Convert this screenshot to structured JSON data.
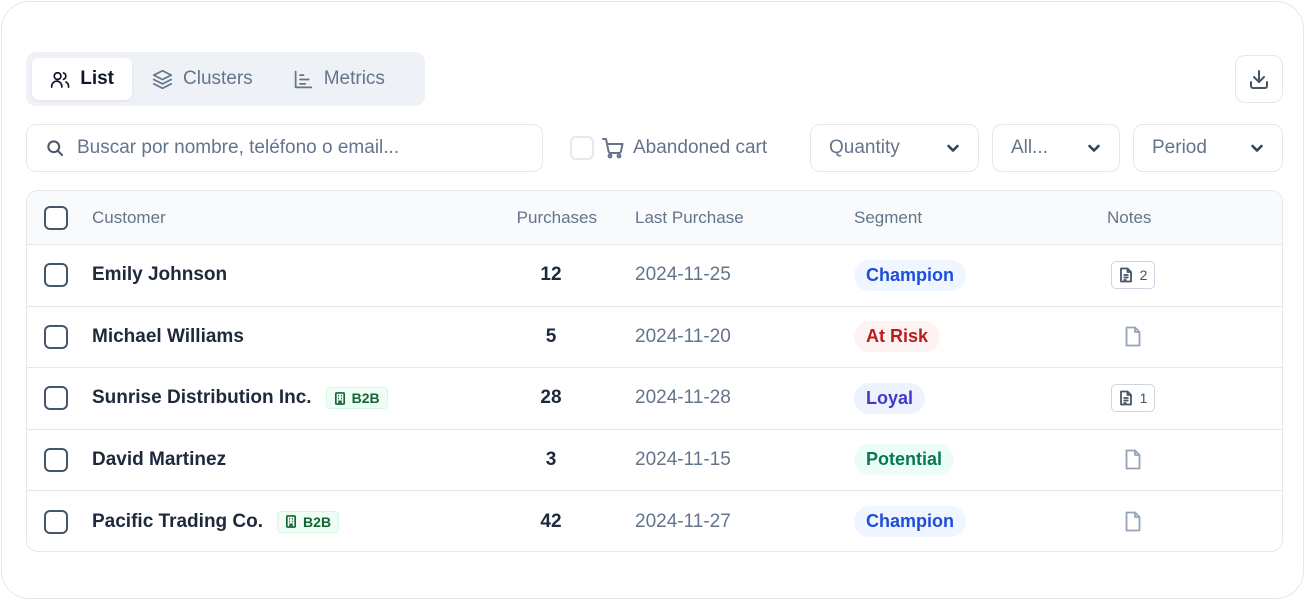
{
  "tabs": [
    {
      "label": "List",
      "icon": "users-icon",
      "active": true
    },
    {
      "label": "Clusters",
      "icon": "layers-icon",
      "active": false
    },
    {
      "label": "Metrics",
      "icon": "bar-chart-icon",
      "active": false
    }
  ],
  "toolbar": {
    "download_icon": "download-icon"
  },
  "filters": {
    "search_placeholder": "Buscar por nombre, teléfono o email...",
    "abandoned_label": "Abandoned cart",
    "quantity_label": "Quantity",
    "all_label": "All...",
    "period_label": "Period"
  },
  "table": {
    "headers": {
      "customer": "Customer",
      "purchases": "Purchases",
      "last_purchase": "Last Purchase",
      "segment": "Segment",
      "notes": "Notes"
    },
    "rows": [
      {
        "name": "Emily Johnson",
        "b2b": "",
        "purchases": "12",
        "last": "2024-11-25",
        "segment": "Champion",
        "notes": "2"
      },
      {
        "name": "Michael Williams",
        "b2b": "",
        "purchases": "5",
        "last": "2024-11-20",
        "segment": "At Risk",
        "notes": ""
      },
      {
        "name": "Sunrise Distribution Inc.",
        "b2b": "B2B",
        "purchases": "28",
        "last": "2024-11-28",
        "segment": "Loyal",
        "notes": "1"
      },
      {
        "name": "David Martinez",
        "b2b": "",
        "purchases": "3",
        "last": "2024-11-15",
        "segment": "Potential",
        "notes": ""
      },
      {
        "name": "Pacific Trading Co.",
        "b2b": "B2B",
        "purchases": "42",
        "last": "2024-11-27",
        "segment": "Champion",
        "notes": ""
      }
    ]
  },
  "segment_colors": {
    "Champion": {
      "bg": "#eff6ff",
      "fg": "#1d4ed8"
    },
    "At Risk": {
      "bg": "#fef2f2",
      "fg": "#b91c1c"
    },
    "Loyal": {
      "bg": "#eef2ff",
      "fg": "#4338ca"
    },
    "Potential": {
      "bg": "#ecfdf5",
      "fg": "#047857"
    }
  }
}
